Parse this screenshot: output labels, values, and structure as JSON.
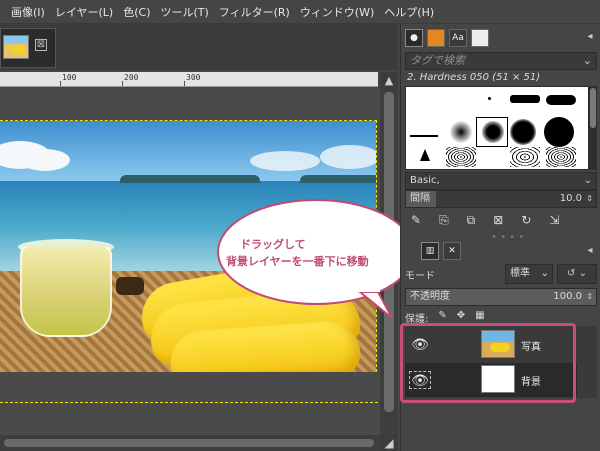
{
  "menubar": {
    "items": [
      "画像(I)",
      "レイヤー(L)",
      "色(C)",
      "ツール(T)",
      "フィルター(R)",
      "ウィンドウ(W)",
      "ヘルプ(H)"
    ]
  },
  "image_tab": {
    "close_glyph": "⊠",
    "thumb_icon": "image-thumbnail"
  },
  "ruler": {
    "labels": [
      "100",
      "200",
      "300"
    ]
  },
  "callout": {
    "line1": "ドラッグして",
    "line2": "背景レイヤーを一番下に移動",
    "color": "#c24a73"
  },
  "brushes_dock": {
    "tag_placeholder": "タグで検索",
    "brush_name": "2. Hardness 050 (51 × 51)",
    "preset_value": "Basic,",
    "spacing_label": "間隔",
    "spacing_value": "10.0"
  },
  "layers_dock": {
    "mode_label": "モード",
    "mode_value": "標準",
    "opacity_label": "不透明度",
    "opacity_value": "100.0",
    "lock_label": "保護:",
    "layers": [
      {
        "name": "写真",
        "visible": true
      },
      {
        "name": "背景",
        "visible": true
      }
    ]
  },
  "colors": {
    "highlight": "#c94d7e",
    "selection": "#e8e800"
  }
}
